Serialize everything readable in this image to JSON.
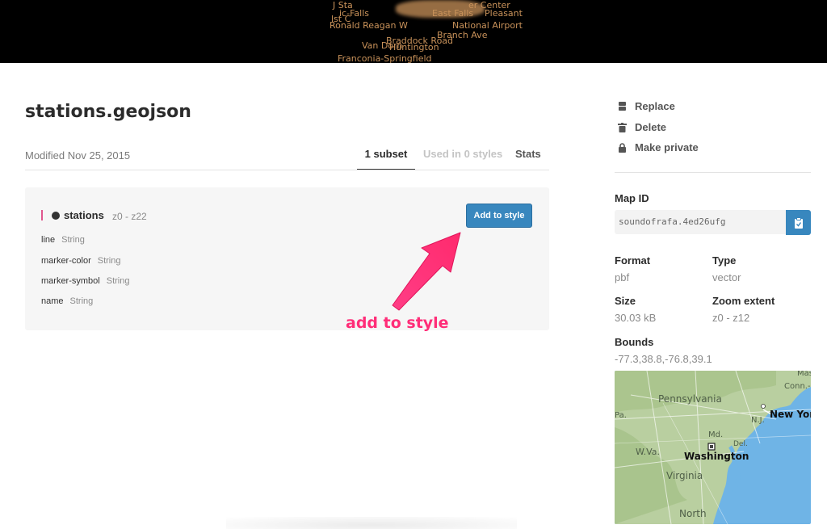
{
  "banner": {
    "labels": [
      "J Sta",
      "ic-Falls",
      "lst C",
      "er Center",
      "East Falls",
      "Pleasant",
      "Ronald Reagan W",
      "National Airport",
      "Branch Ave",
      "Braddock Road",
      "Van Dorn",
      "Huntington",
      "Franconia-Springfield"
    ],
    "color": "#c9925a"
  },
  "dataset": {
    "title": "stations.geojson",
    "modified": "Modified Nov 25, 2015"
  },
  "tabs": {
    "subset": "1 subset",
    "used": "Used in 0 styles",
    "stats": "Stats"
  },
  "layer": {
    "name": "stations",
    "zoom": "z0 - z22",
    "add_label": "Add to style",
    "fields": [
      {
        "name": "line",
        "type": "String"
      },
      {
        "name": "marker-color",
        "type": "String"
      },
      {
        "name": "marker-symbol",
        "type": "String"
      },
      {
        "name": "name",
        "type": "String"
      }
    ]
  },
  "annotation": {
    "text": "add to style",
    "color": "#ff2d78"
  },
  "sidebar": {
    "actions": [
      {
        "label": "Replace",
        "icon": "database-icon"
      },
      {
        "label": "Delete",
        "icon": "trash-icon"
      },
      {
        "label": "Make private",
        "icon": "lock-icon"
      }
    ],
    "map_id_label": "Map ID",
    "map_id": "soundofrafa.4ed26ufg",
    "format_label": "Format",
    "format": "pbf",
    "type_label": "Type",
    "type": "vector",
    "size_label": "Size",
    "size": "30.03 kB",
    "zoom_label": "Zoom extent",
    "zoom": "z0 - z12",
    "bounds_label": "Bounds",
    "bounds": "-77.3,38.8,-76.8,39.1"
  },
  "minimap": {
    "labels": {
      "pennsylvania": "Pennsylvania",
      "washington": "Washington",
      "virginia": "Virginia",
      "wva": "W.Va.",
      "md": "Md.",
      "del": "Del.",
      "nj": "N.J.",
      "newyork": "New York",
      "north": "North",
      "ma": "Mas",
      "conn": "Conn.-",
      "pa": "Pa."
    }
  },
  "colors": {
    "accent": "#3887be",
    "layer_marker": "#e0588e"
  }
}
